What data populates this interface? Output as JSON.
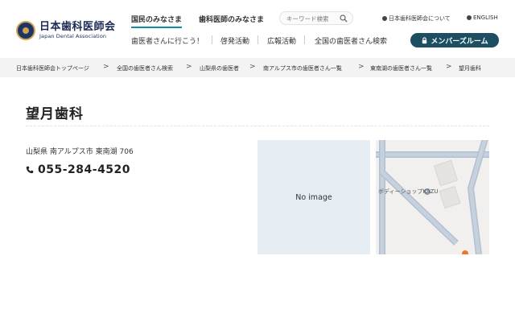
{
  "header": {
    "logo_jp": "日本歯科医師会",
    "logo_en": "Japan Dental Association",
    "tabs": [
      {
        "label": "国民のみなさま",
        "active": true
      },
      {
        "label": "歯科医師のみなさま",
        "active": false
      }
    ],
    "search_placeholder": "キーワード検索",
    "util_links": [
      "日本歯科医師会について",
      "ENGLISH"
    ],
    "sub_nav": [
      "歯医者さんに行こう！",
      "啓発活動",
      "広報活動",
      "全国の歯医者さん検索"
    ],
    "member_button": "メンバーズルーム",
    "accent_color": "#0a8fa3",
    "member_button_color": "#1d4f63"
  },
  "breadcrumb": {
    "items": [
      "日本歯科医師会トップページ",
      "全国の歯医者さん検索",
      "山梨県の歯医者",
      "南アルプス市の歯医者さん一覧",
      "東南湖の歯医者さん一覧",
      "望月歯科"
    ],
    "separator": ">"
  },
  "clinic": {
    "name": "望月歯科",
    "address": "山梨県 南アルプス市 東南湖 706",
    "phone": "055-284-4520",
    "no_image_label": "No image"
  },
  "map": {
    "poi_label": "ボディーショップKAZU"
  }
}
